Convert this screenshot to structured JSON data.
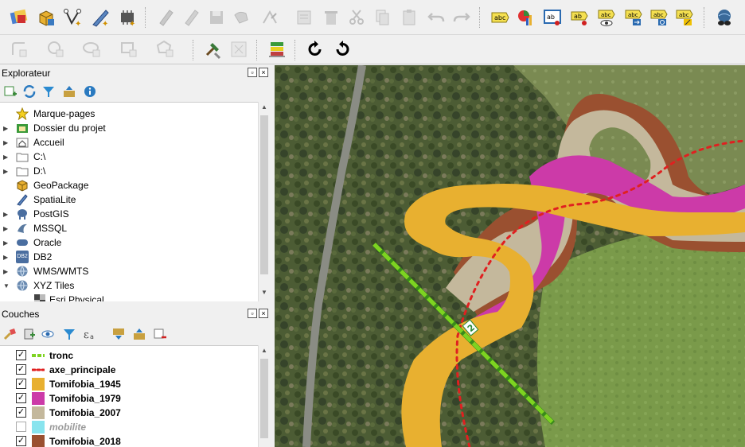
{
  "toolbar1": {
    "labels_text": [
      "abc",
      "abc",
      "abc",
      "abc",
      "abc"
    ],
    "label_ab": [
      "ab",
      "ab"
    ]
  },
  "explorer": {
    "title": "Explorateur",
    "items": [
      {
        "label": "Marque-pages",
        "icon": "star-icon",
        "expandable": false
      },
      {
        "label": "Dossier du projet",
        "icon": "project-folder-icon",
        "expandable": true
      },
      {
        "label": "Accueil",
        "icon": "home-folder-icon",
        "expandable": true
      },
      {
        "label": "C:\\",
        "icon": "drive-folder-icon",
        "expandable": true
      },
      {
        "label": "D:\\",
        "icon": "drive-folder-icon",
        "expandable": true
      },
      {
        "label": "GeoPackage",
        "icon": "geopackage-icon",
        "expandable": false
      },
      {
        "label": "SpatiaLite",
        "icon": "spatialite-icon",
        "expandable": false
      },
      {
        "label": "PostGIS",
        "icon": "postgis-icon",
        "expandable": true
      },
      {
        "label": "MSSQL",
        "icon": "mssql-icon",
        "expandable": true
      },
      {
        "label": "Oracle",
        "icon": "oracle-icon",
        "expandable": true
      },
      {
        "label": "DB2",
        "icon": "db2-icon",
        "expandable": true
      },
      {
        "label": "WMS/WMTS",
        "icon": "globe-icon",
        "expandable": true
      },
      {
        "label": "XYZ Tiles",
        "icon": "globe-icon",
        "expandable": true,
        "expanded": true
      },
      {
        "label": "Esri Physical",
        "icon": "tile-icon",
        "expandable": false,
        "child": true
      }
    ],
    "db2_badge": "DB2"
  },
  "layers": {
    "title": "Couches",
    "items": [
      {
        "name": "tronc",
        "checked": true,
        "symbol": "dashed-green-line"
      },
      {
        "name": "axe_principale",
        "checked": true,
        "symbol": "dotted-red-line"
      },
      {
        "name": "Tomifobia_1945",
        "checked": true,
        "symbol": "fill",
        "color": "#e8b030"
      },
      {
        "name": "Tomifobia_1979",
        "checked": true,
        "symbol": "fill",
        "color": "#cc3aa8"
      },
      {
        "name": "Tomifobia_2007",
        "checked": true,
        "symbol": "fill",
        "color": "#c4b89c"
      },
      {
        "name": "mobilite",
        "checked": false,
        "symbol": "fill",
        "color": "#88e4ee"
      },
      {
        "name": "Tomifobia_2018",
        "checked": true,
        "symbol": "fill",
        "color": "#9a5030"
      }
    ]
  },
  "map": {
    "label_tronc": "2",
    "colors": {
      "t1945": "#e8b030",
      "t1979": "#cc3aa8",
      "t2007": "#c4b89c",
      "t2018": "#9a5030",
      "tronc": "#7ed321",
      "axe": "#e02020"
    }
  }
}
